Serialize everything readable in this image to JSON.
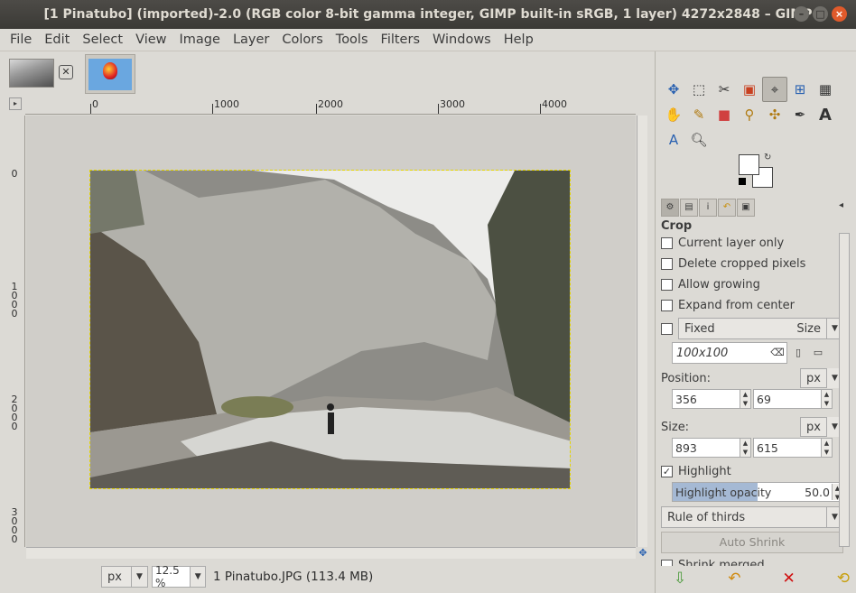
{
  "window": {
    "title": "[1 Pinatubo] (imported)-2.0 (RGB color 8-bit gamma integer, GIMP built-in sRGB, 1 layer) 4272x2848 – GIMP"
  },
  "menu": [
    "File",
    "Edit",
    "Select",
    "View",
    "Image",
    "Layer",
    "Colors",
    "Tools",
    "Filters",
    "Windows",
    "Help"
  ],
  "image_tabs": [
    {
      "name": "pinatubo-thumbnail"
    },
    {
      "name": "balloon-thumbnail"
    }
  ],
  "hruler": {
    "labels": [
      "0",
      "1000",
      "2000",
      "3000",
      "4000"
    ]
  },
  "vruler": {
    "labels": [
      "0",
      "1000",
      "2000",
      "3000"
    ]
  },
  "status": {
    "unit": "px",
    "zoom": "12.5 %",
    "info": "1 Pinatubo.JPG (113.4 MB)"
  },
  "colors": {
    "foreground": "#ffffff",
    "background": "#ffffff",
    "selection_outline": "#e5d500"
  },
  "tool_options": {
    "title": "Crop",
    "current_layer_only": {
      "label": "Current layer only",
      "checked": false
    },
    "delete_cropped": {
      "label": "Delete cropped pixels",
      "checked": false
    },
    "allow_growing": {
      "label": "Allow growing",
      "checked": false
    },
    "expand_center": {
      "label": "Expand from center",
      "checked": false
    },
    "fixed": {
      "label": "Fixed",
      "mode": "Size",
      "checked": false
    },
    "fixed_value": "100x100",
    "position": {
      "label": "Position:",
      "unit": "px",
      "x": "356",
      "y": "69"
    },
    "size": {
      "label": "Size:",
      "unit": "px",
      "w": "893",
      "h": "615"
    },
    "highlight": {
      "label": "Highlight",
      "checked": true
    },
    "highlight_opacity": {
      "label": "Highlight opacity",
      "value": "50.0",
      "fraction": 0.5
    },
    "guides": "Rule of thirds",
    "auto_shrink": "Auto Shrink",
    "shrink_merged": {
      "label": "Shrink merged",
      "checked": false
    }
  }
}
